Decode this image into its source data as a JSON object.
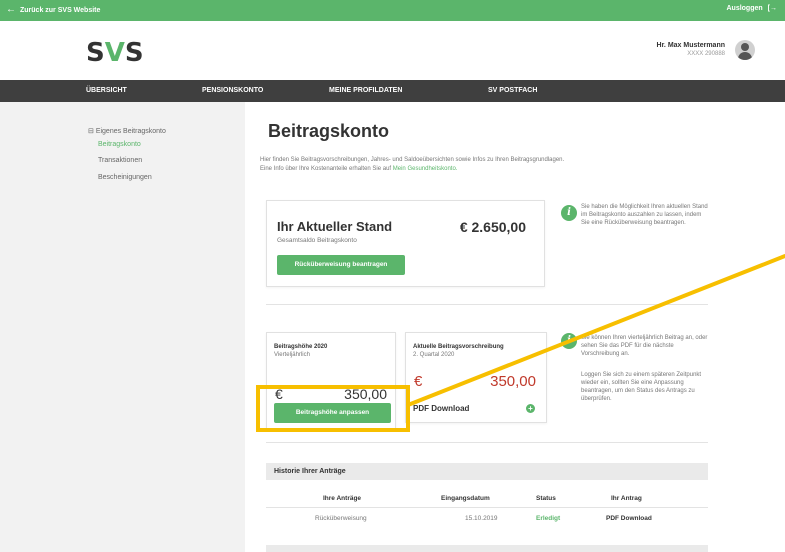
{
  "topbar": {
    "back_label": "Zurück zur SVS Website",
    "logout_label": "Ausloggen"
  },
  "header": {
    "logo_prefix": "S",
    "logo_slash": "V",
    "logo_suffix": "S",
    "user_name": "Hr. Max Mustermann",
    "user_number": "XXXX 290888"
  },
  "nav": {
    "items": [
      "ÜBERSICHT",
      "PENSIONSKONTO",
      "MEINE PROFILDATEN",
      "SV POSTFACH"
    ]
  },
  "sidebar": {
    "parent": "Eigenes Beitragskonto",
    "items": [
      "Beitragskonto",
      "Transaktionen",
      "Bescheinigungen"
    ]
  },
  "main": {
    "title": "Beitragskonto",
    "intro_1": "Hier finden Sie Beitragsvorschreibungen, Jahres- und Saldoeübersichten sowie Infos zu Ihren Beitragsgrundlagen.",
    "intro_2": "Eine Info über Ihre Kostenanteile erhalten Sie auf",
    "intro_link": "Mein Gesundheitskonto."
  },
  "stand": {
    "title": "Ihr Aktueller Stand",
    "subtitle": "Gesamtsaldo Beitragskonto",
    "amount": "€ 2.650,00",
    "button": "Rücküberweisung beantragen"
  },
  "info1": "Sie haben die Möglichkeit Ihren aktuellen Stand im Beitragskonto auszahlen zu lassen, indem Sie eine Rücküberweisung beantragen.",
  "info2a": "Sie können Ihren vierteljährlich Beitrag an, oder sehen Sie das PDF für die nächste Vorschreibung an.",
  "info2b": "Loggen Sie sich zu einem späteren Zeitpunkt wieder ein, sollten Sie eine Anpassung beantragen, um den Status des Antrags zu überprüfen.",
  "beitragshoehe": {
    "title": "Beitragshöhe 2020",
    "subtitle": "Vierteljährlich",
    "currency": "€",
    "amount": "350,00",
    "button": "Beitragshöhe anpassen"
  },
  "vorschreibung": {
    "title": "Aktuelle Beitragsvorschreibung",
    "subtitle": "2. Quartal 2020",
    "currency": "€",
    "amount": "350,00",
    "pdf": "PDF Download"
  },
  "history": {
    "title": "Historie Ihrer Anträge",
    "headers": [
      "Ihre Anträge",
      "Eingangsdatum",
      "Status",
      "Ihr Antrag"
    ],
    "rows": [
      [
        "Rücküberweisung",
        "15.10.2019",
        "Erledigt",
        "PDF Download"
      ]
    ]
  },
  "colors": {
    "brand_green": "#5bb56b",
    "nav_dark": "#3f3f3f",
    "highlight_yellow": "#f7bf00",
    "amount_red": "#c0392b"
  }
}
